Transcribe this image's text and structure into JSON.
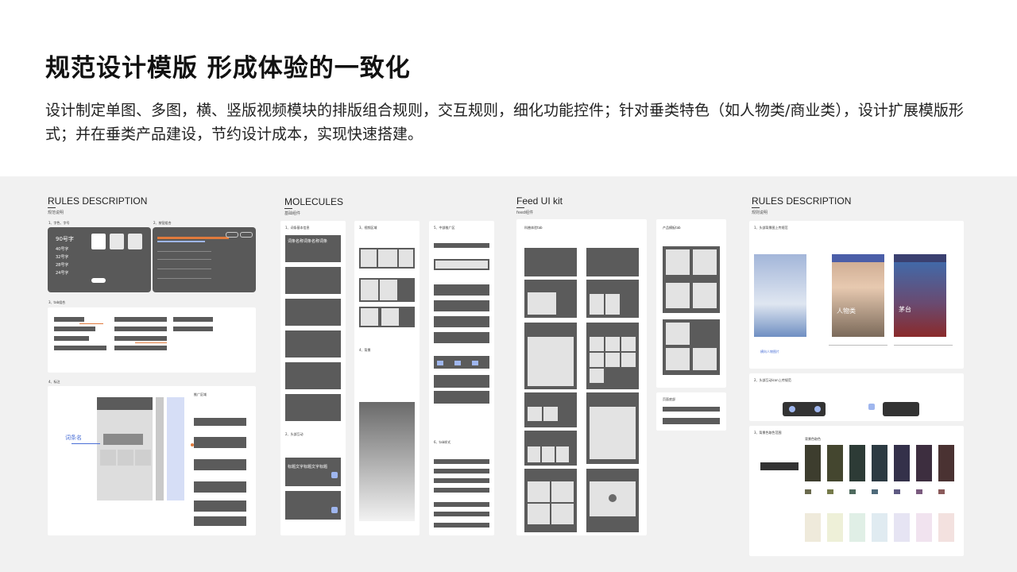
{
  "header": {
    "title": "规范设计模版 形成体验的一致化",
    "description": "设计制定单图、多图，横、竖版视频模块的排版组合规则，交互规则，细化功能控件；针对垂类特色（如人物类/商业类），设计扩展模版形式；并在垂类产品建设，节约设计成本，实现快速搭建。"
  },
  "panels": [
    {
      "heading": "RULES DESCRIPTION",
      "sub": "规范说明"
    },
    {
      "heading": "MOLECULES",
      "sub": "基础组件"
    },
    {
      "heading": "Feed UI kit",
      "sub": "feed组件"
    },
    {
      "heading": "RULES DESCRIPTION",
      "sub": "规则说明"
    }
  ],
  "details": {
    "p1": {
      "s1": "1、字色、字号",
      "s2": "2、按钮组合",
      "s3": "3、tab组合",
      "s4": "4、标注",
      "big_num": "90号字",
      "callout": "词条名",
      "label_area": "推广区域",
      "rows": [
        "40号字",
        "32号字",
        "28号字",
        "24号字"
      ]
    },
    "p2": {
      "c1_title": "1、词条基本信息",
      "c1_item": "词条名称词条名称词条",
      "c1_foot": "2、头部互动",
      "c1_head": "标题文字标题文字标题",
      "c2_title": "3、视频区域",
      "c2_foot": "4、背景",
      "c3_title": "5、中部推广区",
      "c3_b": "6、tab样式"
    },
    "p3": {
      "c1_title": "科普体验tab",
      "c2_title": "产品模板tab",
      "c2_b": "页面底部"
    },
    "p4": {
      "s1": "1、头部背景图上传规范",
      "s2": "2、头部互动icon上传规范",
      "s3": "3、背景色取色范围",
      "cap1": "横向人物图片",
      "cap2": "人物类",
      "cap3": "茅台",
      "swatch_label": "背景色取色"
    }
  }
}
